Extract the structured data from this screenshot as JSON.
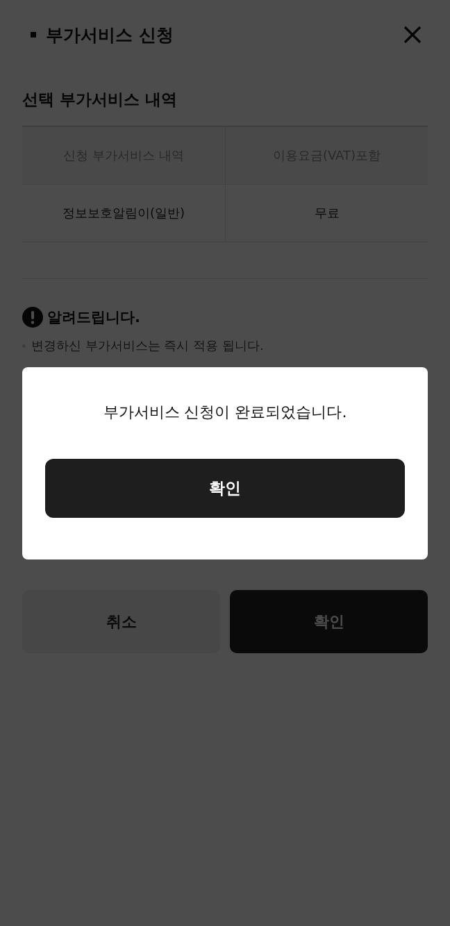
{
  "header": {
    "title": "부가서비스 신청"
  },
  "section_title": "선택 부가서비스 내역",
  "table": {
    "columns": [
      "신청 부가서비스 내역",
      "이용요금(VAT)포함"
    ],
    "rows": [
      [
        "정보보호알림이(일반)",
        "무료"
      ]
    ]
  },
  "notice": {
    "title": "알려드립니다.",
    "items": [
      "변경하신 부가서비스는 즉시 적용 됩니다."
    ]
  },
  "buttons": [
    {
      "label": "취소",
      "kind": "secondary"
    },
    {
      "label": "확인",
      "kind": "primary"
    }
  ],
  "dialog": {
    "message": "부가서비스 신청이 완료되었습니다.",
    "button": "확인"
  }
}
